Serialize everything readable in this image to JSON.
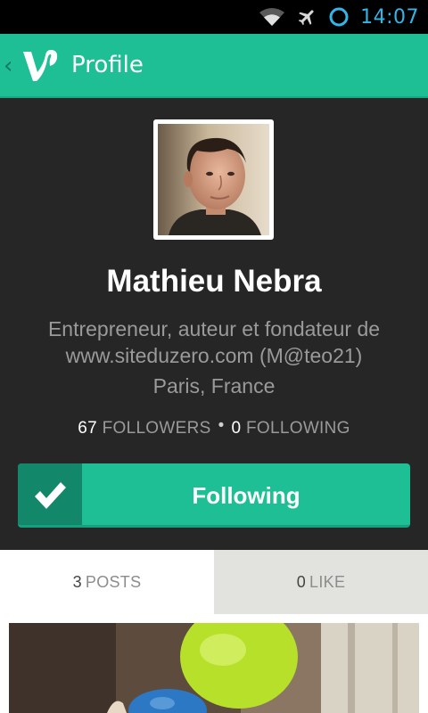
{
  "status_bar": {
    "time": "14:07",
    "icons": [
      "wifi-icon",
      "airplane-mode-icon",
      "sync-circle-icon"
    ]
  },
  "action_bar": {
    "title": "Profile",
    "back_icon": "chevron-left-icon",
    "logo": "vine-logo"
  },
  "profile": {
    "name": "Mathieu Nebra",
    "bio": "Entrepreneur, auteur et fondateur de www.siteduzero.com (M@teo21)",
    "location": "Paris, France",
    "followers_count": "67",
    "followers_label": "FOLLOWERS",
    "separator": "•",
    "following_count": "0",
    "following_label": "FOLLOWING"
  },
  "follow_button": {
    "label": "Following",
    "icon": "checkmark-icon"
  },
  "tabs": [
    {
      "count": "3",
      "label": "POSTS",
      "selected": true
    },
    {
      "count": "0",
      "label": "LIKE",
      "selected": false
    }
  ],
  "colors": {
    "accent": "#1fbf95",
    "accent_dark": "#12876a",
    "status_blue": "#33b5e5",
    "background": "#262626"
  }
}
